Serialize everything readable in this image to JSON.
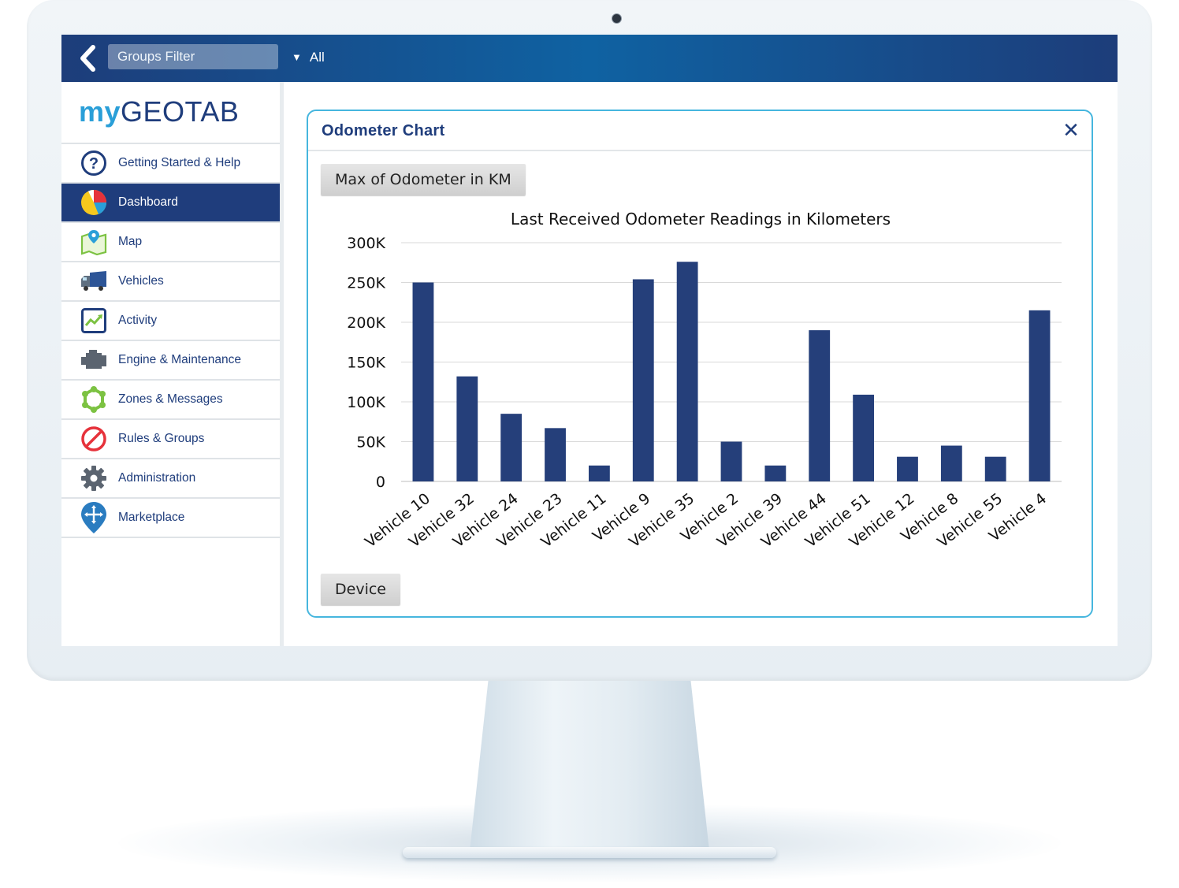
{
  "topbar": {
    "groups_filter_placeholder": "Groups Filter",
    "filter_value": "All"
  },
  "logo": {
    "my": "my",
    "brand": "GEOTAB"
  },
  "sidebar": {
    "items": [
      {
        "label": "Getting Started & Help",
        "icon": "help-icon",
        "active": false
      },
      {
        "label": "Dashboard",
        "icon": "pie-chart-icon",
        "active": true
      },
      {
        "label": "Map",
        "icon": "map-icon",
        "active": false
      },
      {
        "label": "Vehicles",
        "icon": "truck-icon",
        "active": false
      },
      {
        "label": "Activity",
        "icon": "activity-icon",
        "active": false
      },
      {
        "label": "Engine & Maintenance",
        "icon": "engine-icon",
        "active": false
      },
      {
        "label": "Zones & Messages",
        "icon": "zones-icon",
        "active": false
      },
      {
        "label": "Rules & Groups",
        "icon": "rules-icon",
        "active": false
      },
      {
        "label": "Administration",
        "icon": "gear-icon",
        "active": false
      },
      {
        "label": "Marketplace",
        "icon": "marketplace-icon",
        "active": false
      }
    ]
  },
  "panel": {
    "title": "Odometer Chart",
    "metric_button": "Max of Odometer in KM",
    "device_button": "Device"
  },
  "colors": {
    "accent": "#1f3d7c",
    "bar": "#253f7a",
    "panel_border": "#46b6de"
  },
  "chart_data": {
    "type": "bar",
    "title": "Last Received Odometer Readings in Kilometers",
    "xlabel": "",
    "ylabel": "",
    "ylim": [
      0,
      300000
    ],
    "yticks": [
      0,
      50000,
      100000,
      150000,
      200000,
      250000,
      300000
    ],
    "ytick_labels": [
      "0",
      "50K",
      "100K",
      "150K",
      "200K",
      "250K",
      "300K"
    ],
    "grid": true,
    "categories": [
      "Vehicle 10",
      "Vehicle 32",
      "Vehicle 24",
      "Vehicle 23",
      "Vehicle 11",
      "Vehicle 9",
      "Vehicle 35",
      "Vehicle 2",
      "Vehicle 39",
      "Vehicle 44",
      "Vehicle 51",
      "Vehicle 12",
      "Vehicle 8",
      "Vehicle 55",
      "Vehicle 4"
    ],
    "values": [
      250000,
      132000,
      85000,
      67000,
      20000,
      254000,
      276000,
      50000,
      20000,
      190000,
      109000,
      31000,
      45000,
      31000,
      215000
    ]
  }
}
